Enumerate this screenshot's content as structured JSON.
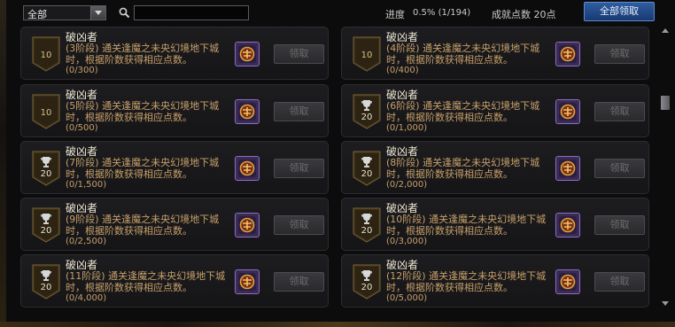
{
  "filter": {
    "selected": "全部"
  },
  "search": {
    "placeholder": ""
  },
  "header": {
    "progress_label": "进度",
    "progress_value": "0.5% (1/194)",
    "points_label": "成就点数 20点",
    "claim_all_label": "全部领取"
  },
  "achievements": [
    {
      "title": "破凶者",
      "desc": "(3阶段) 通关逢魔之未央幻境地下城时，根据阶数获得相应点数。",
      "progress": "(0/300)",
      "points": "10",
      "badge": "shield"
    },
    {
      "title": "破凶者",
      "desc": "(4阶段) 通关逢魔之未央幻境地下城时，根据阶数获得相应点数。",
      "progress": "(0/400)",
      "points": "10",
      "badge": "shield"
    },
    {
      "title": "破凶者",
      "desc": "(5阶段) 通关逢魔之未央幻境地下城时，根据阶数获得相应点数。",
      "progress": "(0/500)",
      "points": "10",
      "badge": "shield"
    },
    {
      "title": "破凶者",
      "desc": "(6阶段) 通关逢魔之未央幻境地下城时，根据阶数获得相应点数。",
      "progress": "(0/1,000)",
      "points": "20",
      "badge": "trophy"
    },
    {
      "title": "破凶者",
      "desc": "(7阶段) 通关逢魔之未央幻境地下城时，根据阶数获得相应点数。",
      "progress": "(0/1,500)",
      "points": "20",
      "badge": "trophy"
    },
    {
      "title": "破凶者",
      "desc": "(8阶段) 通关逢魔之未央幻境地下城时，根据阶数获得相应点数。",
      "progress": "(0/2,000)",
      "points": "20",
      "badge": "trophy"
    },
    {
      "title": "破凶者",
      "desc": "(9阶段) 通关逢魔之未央幻境地下城时，根据阶数获得相应点数。",
      "progress": "(0/2,500)",
      "points": "20",
      "badge": "trophy"
    },
    {
      "title": "破凶者",
      "desc": "(10阶段) 通关逢魔之未央幻境地下城时，根据阶数获得相应点数。",
      "progress": "(0/3,000)",
      "points": "20",
      "badge": "trophy"
    },
    {
      "title": "破凶者",
      "desc": "(11阶段) 通关逢魔之未央幻境地下城时，根据阶数获得相应点数。",
      "progress": "(0/4,000)",
      "points": "20",
      "badge": "trophy"
    },
    {
      "title": "破凶者",
      "desc": "(12阶段) 通关逢魔之未央幻境地下城时，根据阶数获得相应点数。",
      "progress": "(0/5,000)",
      "points": "20",
      "badge": "trophy"
    }
  ],
  "claim_label": "领取",
  "colors": {
    "accent": "#2f5da0",
    "desc_text": "#c8a06a",
    "reward_frame": "#8a6fc0"
  },
  "icons": {
    "filter_arrow": "chevron-down-icon",
    "search": "search-icon",
    "badge_trophy": "trophy-icon",
    "badge_shield": "shield-icon",
    "reward": "reward-box-icon"
  }
}
